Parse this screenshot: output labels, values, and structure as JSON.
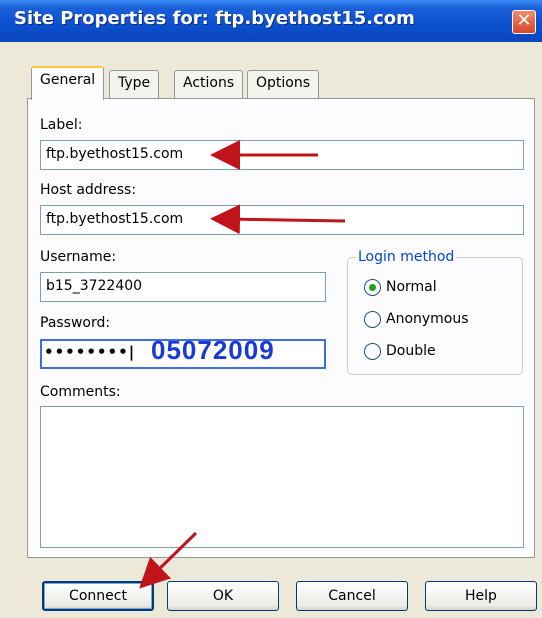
{
  "window": {
    "title": "Site Properties for: ftp.byethost15.com",
    "close_glyph": "✕"
  },
  "tabs": [
    {
      "label": "General",
      "active": true
    },
    {
      "label": "Type",
      "active": false
    },
    {
      "label": "Actions",
      "active": false
    },
    {
      "label": "Options",
      "active": false
    }
  ],
  "form": {
    "label_caption": "Label:",
    "label_value": "ftp.byethost15.com",
    "host_caption": "Host address:",
    "host_value": "ftp.byethost15.com",
    "username_caption": "Username:",
    "username_value": "b15_3722400",
    "password_caption": "Password:",
    "password_masked": "••••••••|",
    "password_annotation": "05072009",
    "comments_caption": "Comments:",
    "comments_value": ""
  },
  "login_method": {
    "legend": "Login method",
    "options": [
      {
        "label": "Normal",
        "selected": true
      },
      {
        "label": "Anonymous",
        "selected": false
      },
      {
        "label": "Double",
        "selected": false
      }
    ]
  },
  "buttons": {
    "connect": "Connect",
    "ok": "OK",
    "cancel": "Cancel",
    "help": "Help"
  },
  "colors": {
    "annotation_arrow": "#c0141a",
    "annotation_text": "#1a3ad8",
    "titlebar": "#0b4fd0"
  }
}
